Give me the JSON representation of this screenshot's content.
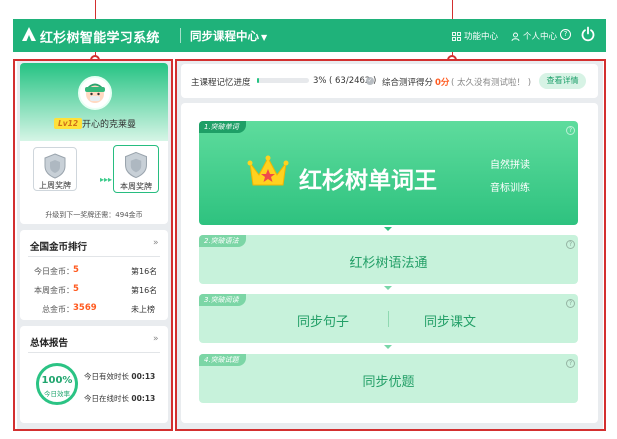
{
  "header": {
    "app_title": "红杉树智能学习系统",
    "course_menu_label": "同步课程中心",
    "function_center_label": "功能中心",
    "personal_center_label": "个人中心"
  },
  "profile": {
    "level": "Lv12",
    "username": "开心的克莱曼",
    "last_week_medal_label": "上周奖牌",
    "this_week_medal_label": "本周奖牌",
    "upgrade_text": "升级到下一奖牌还需：494金币"
  },
  "ranking": {
    "title": "全国金币排行",
    "more": "»",
    "rows": [
      {
        "label": "今日金币：",
        "value": "5",
        "rank": "第16名"
      },
      {
        "label": "本周金币：",
        "value": "5",
        "rank": "第16名"
      },
      {
        "label": "总金币：",
        "value": "3569",
        "rank": "未上榜"
      }
    ]
  },
  "report": {
    "title": "总体报告",
    "more": "»",
    "efficiency_value": "100%",
    "efficiency_label": "今日效率",
    "effective_label": "今日有效时长",
    "effective_value": "00:13",
    "online_label": "今日在线时长",
    "online_value": "00:13"
  },
  "progress": {
    "label": "主课程记忆进度",
    "percent_text": "3%",
    "count_text": "( 63/2462 )",
    "fraction": 0.03,
    "score_label": "综合测评得分",
    "score_value": "0分",
    "score_note": "( 太久没有测试啦！ )",
    "detail_button": "查看详情"
  },
  "tiles": {
    "words": {
      "tag": "1.突破单词",
      "title": "红杉树单词王",
      "links": [
        "自然拼读",
        "音标训练"
      ]
    },
    "grammar": {
      "tag": "2.突破语法",
      "title": "红杉树语法通"
    },
    "reading": {
      "tag": "3.突破阅读",
      "items": [
        "同步句子",
        "同步课文"
      ]
    },
    "exam": {
      "tag": "4.突破试题",
      "title": "同步优题"
    }
  },
  "colors": {
    "brand_green": "#1fb27a",
    "accent_orange": "#ff5a1f",
    "annotation_red": "#d32f2f"
  }
}
